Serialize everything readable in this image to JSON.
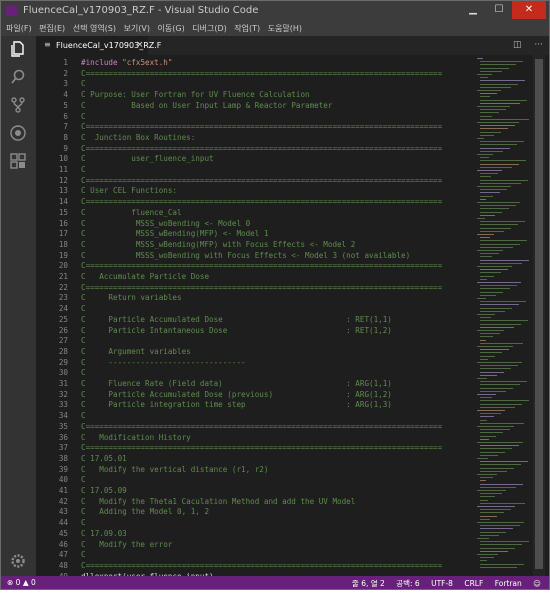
{
  "window": {
    "title": "FluenceCal_v170903_RZ.F - Visual Studio Code",
    "controls": {
      "minimize": "▁",
      "maximize": "☐",
      "close": "✕"
    }
  },
  "menu": [
    "파일(F)",
    "편집(E)",
    "선택 영역(S)",
    "보기(V)",
    "이동(G)",
    "디버그(D)",
    "작업(T)",
    "도움말(H)"
  ],
  "activity_bar": [
    "files-icon",
    "search-icon",
    "source-control-icon",
    "debug-icon",
    "extensions-icon",
    "gear-icon"
  ],
  "tab": {
    "label": "FluenceCal_v170903_RZ.F",
    "close": "×"
  },
  "tab_actions": {
    "split": "◫",
    "more": "···"
  },
  "editor": {
    "lines": [
      {
        "n": "1",
        "text": "#include \"cfx5ext.h\"",
        "type": "kw"
      },
      {
        "n": "2",
        "text": "C==============================================================================",
        "type": "comment"
      },
      {
        "n": "3",
        "text": "C",
        "type": "comment"
      },
      {
        "n": "4",
        "text": "C Purpose: User Fortran for UV Fluence Calculation",
        "type": "comment"
      },
      {
        "n": "5",
        "text": "C          Based on User Input Lamp & Reactor Parameter",
        "type": "comment"
      },
      {
        "n": "6",
        "text": "C",
        "type": "comment"
      },
      {
        "n": "7",
        "text": "C==============================================================================",
        "type": "comment"
      },
      {
        "n": "8",
        "text": "C  Junction Box Routines:",
        "type": "comment"
      },
      {
        "n": "9",
        "text": "C==============================================================================",
        "type": "comment"
      },
      {
        "n": "10",
        "text": "C          user_fluence_input",
        "type": "comment"
      },
      {
        "n": "11",
        "text": "C",
        "type": "comment"
      },
      {
        "n": "12",
        "text": "C==============================================================================",
        "type": "comment"
      },
      {
        "n": "13",
        "text": "C User CEL Functions:",
        "type": "comment"
      },
      {
        "n": "14",
        "text": "C==============================================================================",
        "type": "comment"
      },
      {
        "n": "15",
        "text": "C          fluence_Cal",
        "type": "comment"
      },
      {
        "n": "16",
        "text": "C           MSSS_woBending <- Model 0",
        "type": "comment"
      },
      {
        "n": "17",
        "text": "C           MSSS_wBending(MFP) <- Model 1",
        "type": "comment"
      },
      {
        "n": "18",
        "text": "C           MSSS_wBending(MFP) with Focus Effects <- Model 2",
        "type": "comment"
      },
      {
        "n": "19",
        "text": "C           MSSS_woBending with Focus Effects <- Model 3 (not available)",
        "type": "comment"
      },
      {
        "n": "20",
        "text": "C==============================================================================",
        "type": "comment"
      },
      {
        "n": "21",
        "text": "C   Accumulate Particle Dose",
        "type": "comment"
      },
      {
        "n": "22",
        "text": "C==============================================================================",
        "type": "comment"
      },
      {
        "n": "23",
        "text": "C     Return variables",
        "type": "comment"
      },
      {
        "n": "24",
        "text": "C",
        "type": "comment"
      },
      {
        "n": "25",
        "text": "C     Particle Accumulated Dose                           : RET(1,1)",
        "type": "comment"
      },
      {
        "n": "26",
        "text": "C     Particle Intantaneous Dose                          : RET(1,2)",
        "type": "comment"
      },
      {
        "n": "27",
        "text": "C",
        "type": "comment"
      },
      {
        "n": "28",
        "text": "C     Argument variables",
        "type": "comment"
      },
      {
        "n": "29",
        "text": "C     ------------------------------",
        "type": "comment"
      },
      {
        "n": "30",
        "text": "C",
        "type": "comment"
      },
      {
        "n": "31",
        "text": "C     Fluence Rate (Field data)                           : ARG(1,1)",
        "type": "comment"
      },
      {
        "n": "32",
        "text": "C     Particle Accumulated Dose (previous)                : ARG(1,2)",
        "type": "comment"
      },
      {
        "n": "33",
        "text": "C     Particle integration time step                      : ARG(1,3)",
        "type": "comment"
      },
      {
        "n": "34",
        "text": "C",
        "type": "comment"
      },
      {
        "n": "35",
        "text": "C==============================================================================",
        "type": "comment"
      },
      {
        "n": "36",
        "text": "C   Modification History",
        "type": "comment"
      },
      {
        "n": "37",
        "text": "C==============================================================================",
        "type": "comment"
      },
      {
        "n": "38",
        "text": "C 17.05.01",
        "type": "comment"
      },
      {
        "n": "39",
        "text": "C   Modify the vertical distance (r1, r2)",
        "type": "comment"
      },
      {
        "n": "40",
        "text": "C",
        "type": "comment"
      },
      {
        "n": "41",
        "text": "C 17.05.09",
        "type": "comment"
      },
      {
        "n": "42",
        "text": "C   Modify the Theta1 Caculation Method and add the UV Model",
        "type": "comment"
      },
      {
        "n": "43",
        "text": "C   Adding the Model 0, 1, 2",
        "type": "comment"
      },
      {
        "n": "44",
        "text": "C",
        "type": "comment"
      },
      {
        "n": "45",
        "text": "C 17.09.03",
        "type": "comment"
      },
      {
        "n": "46",
        "text": "C   Modify the error",
        "type": "comment"
      },
      {
        "n": "47",
        "text": "C",
        "type": "comment"
      },
      {
        "n": "48",
        "text": "C==============================================================================",
        "type": "comment"
      },
      {
        "n": "49",
        "text": "dllexport(user_fluence_input)",
        "type": "plain"
      }
    ]
  },
  "status_bar": {
    "problems": "⊗ 0 ▲ 0",
    "position": "줄 6, 열 2",
    "spaces": "공백: 6",
    "encoding": "UTF-8",
    "eol": "CRLF",
    "language": "Fortran",
    "feedback_icon": "☺"
  },
  "colors": {
    "status_bar": "#68217a",
    "comment": "#608b4e",
    "keyword": "#c586c0",
    "string": "#ce9178",
    "editor_bg": "#1e1e1e"
  }
}
